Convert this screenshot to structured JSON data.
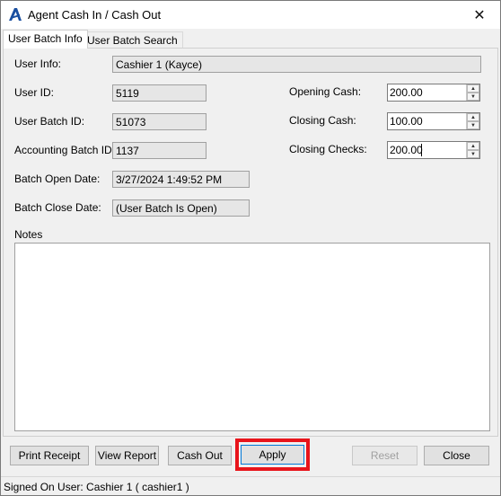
{
  "window": {
    "title": "Agent Cash In / Cash Out",
    "close_glyph": "✕",
    "icon": "agent-logo-icon"
  },
  "tabs": [
    {
      "label": "User Batch Info",
      "active": true
    },
    {
      "label": "User Batch Search",
      "active": false
    }
  ],
  "fields": {
    "user_info": {
      "label": "User Info:",
      "value": "Cashier 1 (Kayce)"
    },
    "user_id": {
      "label": "User ID:",
      "value": "5119"
    },
    "user_batch_id": {
      "label": "User Batch ID:",
      "value": "51073"
    },
    "accounting_batch_id": {
      "label": "Accounting Batch ID:",
      "value": "1137"
    },
    "batch_open_date": {
      "label": "Batch Open Date:",
      "value": "3/27/2024 1:49:52 PM"
    },
    "batch_close_date": {
      "label": "Batch Close Date:",
      "value": "(User Batch Is Open)"
    },
    "opening_cash": {
      "label": "Opening Cash:",
      "value": "200.00"
    },
    "closing_cash": {
      "label": "Closing Cash:",
      "value": "100.00"
    },
    "closing_checks": {
      "label": "Closing Checks:",
      "value": "200.00"
    },
    "notes": {
      "label": "Notes",
      "value": ""
    }
  },
  "buttons": {
    "print_receipt": "Print Receipt",
    "view_report": "View Report",
    "cash_out": "Cash Out",
    "apply": "Apply",
    "reset": "Reset",
    "close": "Close"
  },
  "status": {
    "text": "Signed On User: Cashier 1 ( cashier1 )"
  },
  "colors": {
    "highlight": "#e8141b",
    "logo": "#1a4fa0"
  }
}
